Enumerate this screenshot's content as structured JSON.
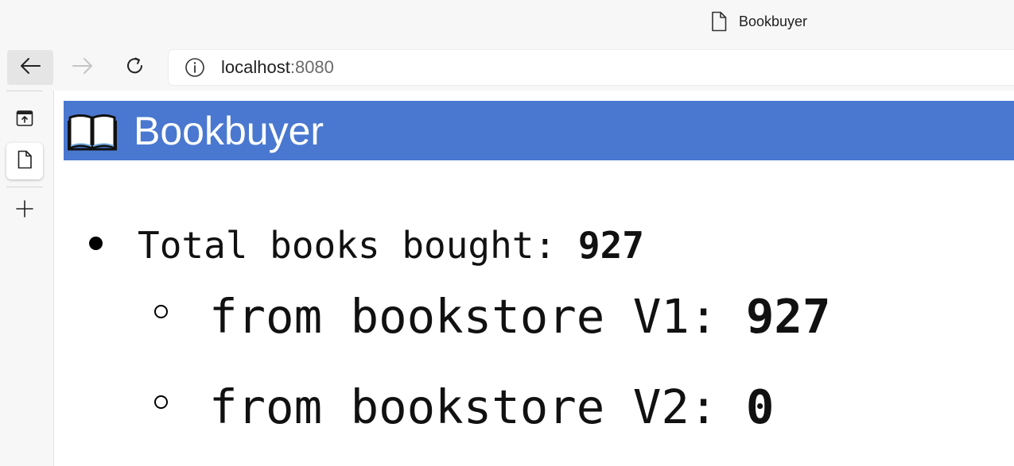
{
  "window": {
    "tab_title": "Bookbuyer",
    "tab_icon": "document-icon"
  },
  "toolbar": {
    "back_icon": "arrow-left-icon",
    "forward_icon": "arrow-right-icon",
    "refresh_icon": "refresh-icon",
    "address": {
      "info_icon": "info-icon",
      "host": "localhost",
      "port": ":8080"
    }
  },
  "sidebar": {
    "items": [
      {
        "icon": "tab-actions-icon"
      },
      {
        "icon": "document-icon",
        "active": true
      },
      {
        "icon": "plus-icon"
      }
    ]
  },
  "page": {
    "header": {
      "icon": "open-book-emoji",
      "title": "Bookbuyer",
      "color": "#4a78d0"
    },
    "stats": {
      "total_label": "Total books bought: ",
      "total_value": "927",
      "v1_label": "from bookstore V1: ",
      "v1_value": "927",
      "v2_label": "from bookstore V2: ",
      "v2_value": "0"
    }
  }
}
